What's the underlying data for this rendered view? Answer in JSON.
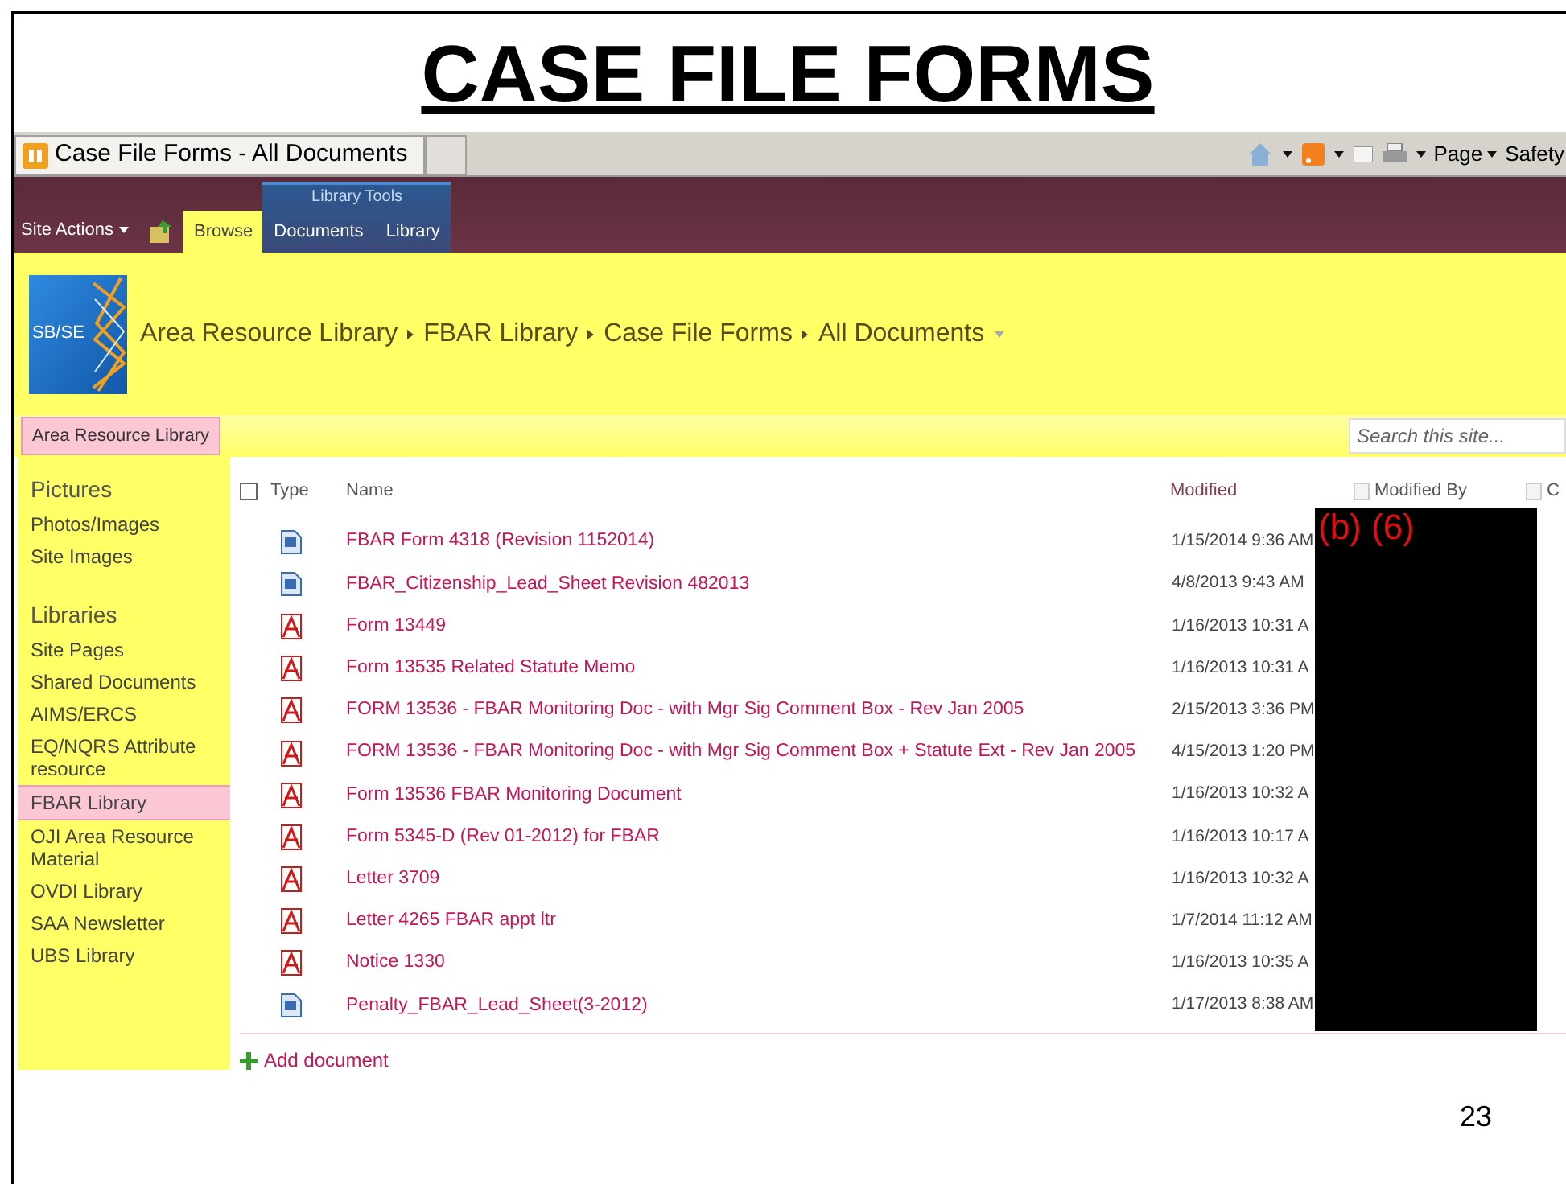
{
  "slide_title": "CASE FILE FORMS",
  "browser": {
    "tab_title": "Case File Forms - All Documents",
    "menus": [
      "Page",
      "Safety"
    ]
  },
  "ribbon": {
    "site_actions": "Site Actions",
    "tabs": [
      {
        "label": "Browse",
        "selected": true
      }
    ],
    "tab_group": {
      "label": "Library Tools",
      "tabs": [
        {
          "label": "Documents",
          "selected": false
        },
        {
          "label": "Library",
          "selected": false
        }
      ]
    }
  },
  "header": {
    "logo_text": "SB/SE",
    "breadcrumb": [
      "Area Resource Library",
      "FBAR Library",
      "Case File Forms",
      "All Documents"
    ]
  },
  "top_link": "Area Resource Library",
  "search": {
    "placeholder": "Search this site..."
  },
  "sidebar": {
    "sections": [
      {
        "heading": "Pictures",
        "items": [
          {
            "label": "Photos/Images",
            "selected": false
          },
          {
            "label": "Site Images",
            "selected": false
          }
        ]
      },
      {
        "heading": "Libraries",
        "items": [
          {
            "label": "Site Pages",
            "selected": false
          },
          {
            "label": "Shared Documents",
            "selected": false
          },
          {
            "label": "AIMS/ERCS",
            "selected": false
          },
          {
            "label": "EQ/NQRS Attribute resource",
            "selected": false
          },
          {
            "label": "FBAR Library",
            "selected": true
          },
          {
            "label": "OJI Area Resource Material",
            "selected": false
          },
          {
            "label": "OVDI Library",
            "selected": false
          },
          {
            "label": "SAA Newsletter",
            "selected": false
          },
          {
            "label": "UBS Library",
            "selected": false
          }
        ]
      }
    ]
  },
  "table": {
    "select_all": {
      "checked": false
    },
    "columns": [
      {
        "label": "Type"
      },
      {
        "label": "Name"
      },
      {
        "label": "Modified"
      },
      {
        "label": "Modified By",
        "checked": false
      },
      {
        "label": "C",
        "checked": false
      }
    ],
    "rows": [
      {
        "kind": "word",
        "name": "FBAR Form 4318 (Revision 1152014)",
        "modified": "1/15/2014 9:36 AM"
      },
      {
        "kind": "word",
        "name": "FBAR_Citizenship_Lead_Sheet Revision 482013",
        "modified": "4/8/2013 9:43 AM"
      },
      {
        "kind": "pdf",
        "name": "Form 13449",
        "modified": "1/16/2013 10:31 A"
      },
      {
        "kind": "pdf",
        "name": "Form 13535 Related Statute Memo",
        "modified": "1/16/2013 10:31 A"
      },
      {
        "kind": "pdf",
        "name": "FORM 13536 - FBAR Monitoring Doc - with Mgr Sig Comment Box - Rev Jan 2005",
        "modified": "2/15/2013 3:36 PM"
      },
      {
        "kind": "pdf",
        "name": "FORM 13536 - FBAR Monitoring Doc - with Mgr Sig Comment Box + Statute Ext - Rev Jan 2005",
        "modified": "4/15/2013 1:20 PM"
      },
      {
        "kind": "pdf",
        "name": "Form 13536 FBAR Monitoring Document",
        "modified": "1/16/2013 10:32 A"
      },
      {
        "kind": "pdf",
        "name": "Form 5345-D (Rev 01-2012) for FBAR",
        "modified": "1/16/2013 10:17 A"
      },
      {
        "kind": "pdf",
        "name": "Letter 3709",
        "modified": "1/16/2013 10:32 A"
      },
      {
        "kind": "pdf",
        "name": "Letter 4265 FBAR appt ltr",
        "modified": "1/7/2014 11:12 AM"
      },
      {
        "kind": "pdf",
        "name": "Notice 1330",
        "modified": "1/16/2013 10:35 A"
      },
      {
        "kind": "word",
        "name": "Penalty_FBAR_Lead_Sheet(3-2012)",
        "modified": "1/17/2013 8:38 AM"
      }
    ]
  },
  "redaction": {
    "label": "(b) (6)"
  },
  "add_document": "Add document",
  "slide_number": "23"
}
